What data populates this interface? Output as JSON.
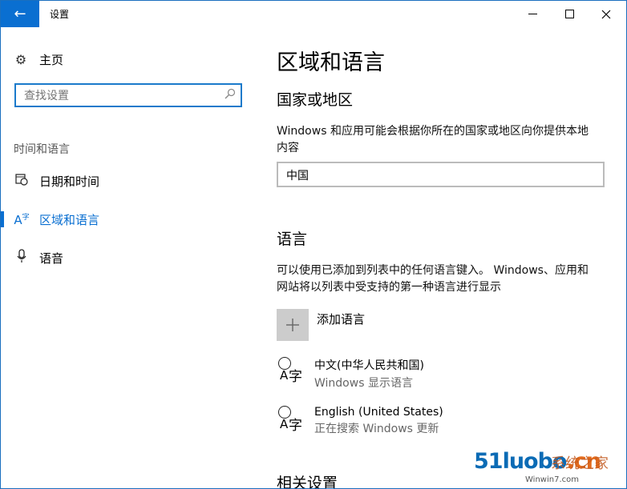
{
  "window": {
    "title": "设置",
    "back_icon": "back-arrow-icon",
    "minimize": "—",
    "maximize": "☐",
    "close": "✕"
  },
  "sidebar": {
    "home_label": "主页",
    "search_placeholder": "查找设置",
    "section_label": "时间和语言",
    "items": [
      {
        "label": "日期和时间",
        "icon": "calendar-clock-icon"
      },
      {
        "label": "区域和语言",
        "icon": "language-icon",
        "active": true
      },
      {
        "label": "语音",
        "icon": "microphone-icon"
      }
    ]
  },
  "main": {
    "title": "区域和语言",
    "country_heading": "国家或地区",
    "country_desc": "Windows 和应用可能会根据你所在的国家或地区向你提供本地内容",
    "country_value": "中国",
    "language_heading": "语言",
    "language_desc": "可以使用已添加到列表中的任何语言键入。 Windows、应用和网站将以列表中受支持的第一种语言进行显示",
    "add_language_label": "添加语言",
    "languages": [
      {
        "name": "中文(中华人民共和国)",
        "status": "Windows 显示语言"
      },
      {
        "name": "English (United States)",
        "status": "正在搜索 Windows 更新"
      }
    ],
    "related_heading": "相关设置"
  },
  "watermark": {
    "logo_main": "51luobo",
    "logo_suffix": ".cn",
    "overlay_text": "系统之家",
    "site": "Winwin7.com"
  },
  "colors": {
    "accent": "#0a6fd1",
    "plus_bg": "#cccccc"
  }
}
